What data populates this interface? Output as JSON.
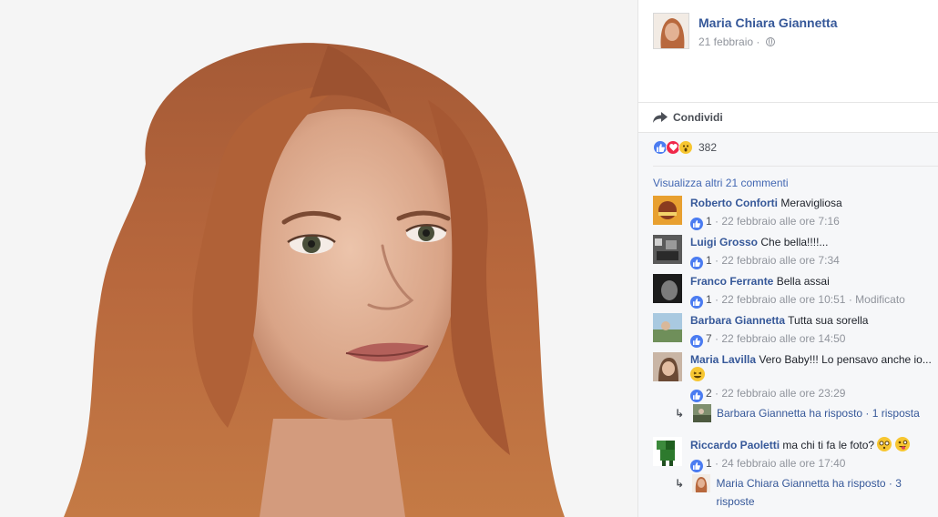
{
  "post": {
    "author": "Maria Chiara Giannetta",
    "date": "21 febbraio",
    "date_separator": "·",
    "privacy_icon": "globe-icon"
  },
  "actions": {
    "share_label": "Condividi",
    "share_icon": "share-arrow-icon"
  },
  "reactions": {
    "types": [
      "like",
      "love",
      "wow"
    ],
    "count": "382"
  },
  "comments_section": {
    "view_more": "Visualizza altri 21 commenti",
    "comments": [
      {
        "author": "Roberto Conforti",
        "text": "Meravigliosa",
        "likes": "1",
        "time": "· 22 febbraio alle ore 7:16",
        "edited": ""
      },
      {
        "author": "Luigi Grosso",
        "text": "Che bella!!!!...",
        "likes": "1",
        "time": "· 22 febbraio alle ore 7:34",
        "edited": ""
      },
      {
        "author": "Franco Ferrante",
        "text": "Bella assai",
        "likes": "1",
        "time": "· 22 febbraio alle ore 10:51",
        "edited": "· Modificato"
      },
      {
        "author": "Barbara Giannetta",
        "text": "Tutta sua sorella",
        "likes": "7",
        "time": "· 22 febbraio alle ore 14:50",
        "edited": ""
      },
      {
        "author": "Maria Lavilla",
        "text": "Vero Baby!!! Lo pensavo anche io...",
        "emoji": "laughing-emoji",
        "likes": "2",
        "time": "· 22 febbraio alle ore 23:29",
        "edited": "",
        "reply": {
          "text": "Barbara Giannetta ha risposto · 1 risposta"
        }
      },
      {
        "author": "Riccardo Paoletti",
        "text": "ma chi ti fa le foto?",
        "emoji": "flushed-emoji, tongue-emoji",
        "likes": "1",
        "time": "· 24 febbraio alle ore 17:40",
        "edited": "",
        "reply": {
          "text": "Maria Chiara Giannetta ha risposto · 3 risposte"
        }
      }
    ]
  },
  "colors": {
    "link_blue": "#365899",
    "meta_gray": "#90949c",
    "like_blue": "#4b7cf1",
    "love_red": "#f0284a",
    "wow_yellow": "#f7c631",
    "panel_bg": "#f6f7f9"
  }
}
